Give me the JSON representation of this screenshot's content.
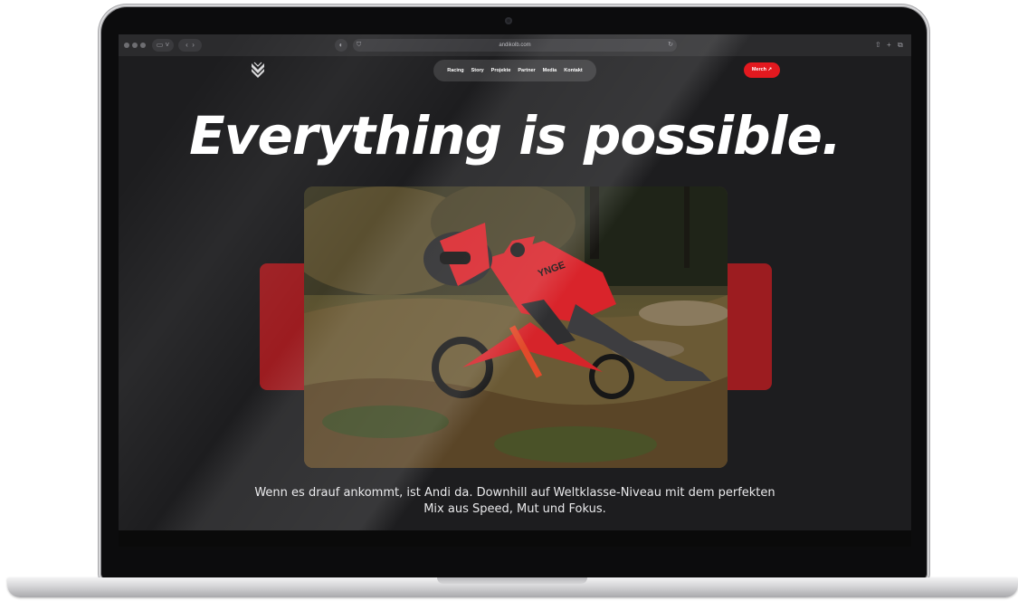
{
  "browser": {
    "url": "andikolb.com"
  },
  "nav": {
    "items": [
      "Racing",
      "Story",
      "Projekte",
      "Partner",
      "Media",
      "Kontakt"
    ]
  },
  "merch": {
    "label": "Merch ↗"
  },
  "hero": {
    "title": "Everything is possible.",
    "description": "Wenn es drauf ankommt, ist Andi da. Downhill auf Weltklasse-Niveau mit dem perfekten Mix aus Speed, Mut und Fokus."
  },
  "colors": {
    "accent": "#e3191f",
    "accent_block": "#9c1c20",
    "background": "#1d1d1f",
    "nav_pill": "#3a3a3c"
  },
  "icons": {
    "logo": "wing-chevron-logo",
    "merch_arrow": "arrow-up-right-icon"
  }
}
